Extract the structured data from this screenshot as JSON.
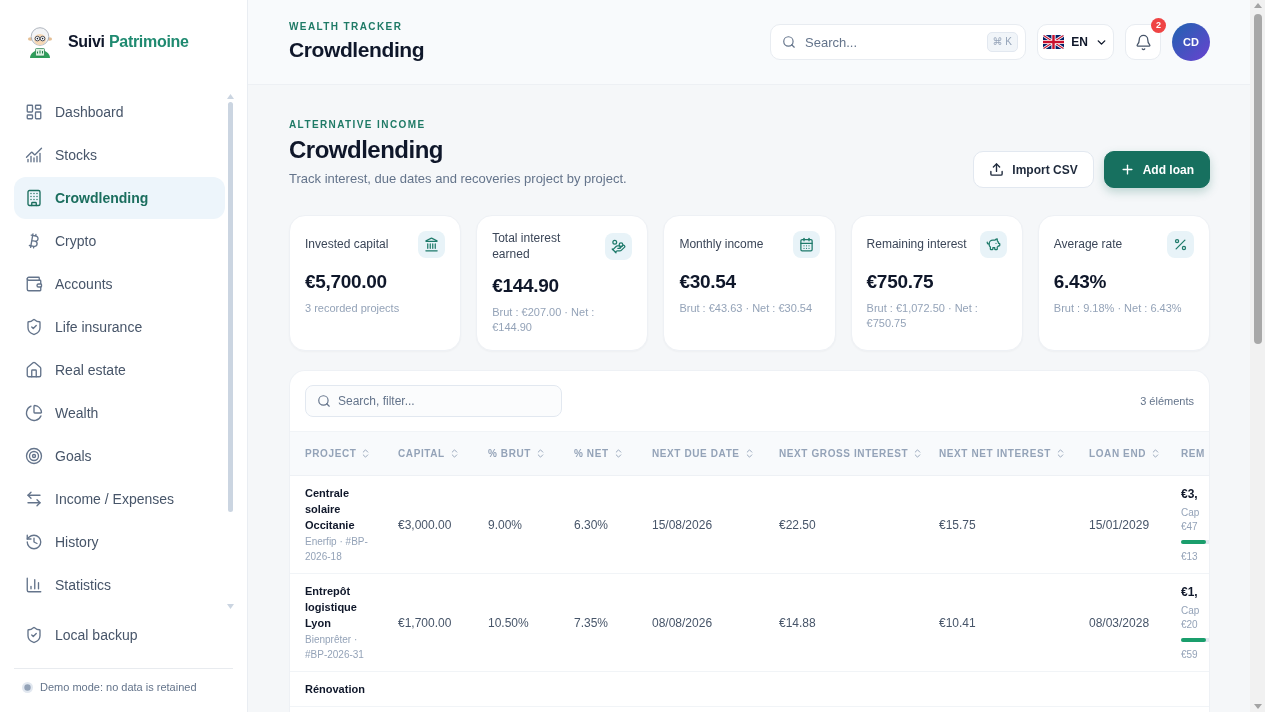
{
  "sidebar": {
    "brand": {
      "first_word": "Suivi",
      "second_word": "Patrimoine"
    },
    "nav_items": [
      {
        "label": "Dashboard",
        "selected": false
      },
      {
        "label": "Stocks",
        "selected": false
      },
      {
        "label": "Crowdlending",
        "selected": true
      },
      {
        "label": "Crypto",
        "selected": false
      },
      {
        "label": "Accounts",
        "selected": false
      },
      {
        "label": "Life insurance",
        "selected": false
      },
      {
        "label": "Real estate",
        "selected": false
      },
      {
        "label": "Wealth",
        "selected": false
      },
      {
        "label": "Goals",
        "selected": false
      },
      {
        "label": "Income / Expenses",
        "selected": false
      },
      {
        "label": "History",
        "selected": false
      },
      {
        "label": "Statistics",
        "selected": false
      }
    ],
    "footer_items": [
      {
        "label": "Local backup",
        "selected": false
      }
    ],
    "demo_notice": "Demo mode: no data is retained"
  },
  "header": {
    "eyebrow": "WEALTH TRACKER",
    "title": "Crowdlending",
    "search": {
      "placeholder": "Search...",
      "shortcut": "⌘ K"
    },
    "language": {
      "code": "EN"
    },
    "notifications": {
      "count": "2"
    },
    "avatar": {
      "initials": "CD"
    }
  },
  "page": {
    "eyebrow": "ALTERNATIVE INCOME",
    "title": "Crowdlending",
    "subtitle": "Track interest, due dates and recoveries project by project.",
    "actions": [
      {
        "label": "Import CSV",
        "kind": "secondary"
      },
      {
        "label": "Add loan",
        "kind": "primary"
      }
    ]
  },
  "stat_cards": [
    {
      "label": "Invested capital",
      "value": "€5,700.00",
      "detail": "3 recorded projects"
    },
    {
      "label": "Total interest earned",
      "value": "€144.90",
      "detail": "Brut : €207.00 · Net : €144.90"
    },
    {
      "label": "Monthly income",
      "value": "€30.54",
      "detail": "Brut : €43.63 · Net : €30.54"
    },
    {
      "label": "Remaining interest",
      "value": "€750.75",
      "detail": "Brut : €1,072.50 · Net : €750.75"
    },
    {
      "label": "Average rate",
      "value": "6.43%",
      "detail": "Brut : 9.18% · Net : 6.43%"
    }
  ],
  "table": {
    "search": {
      "placeholder": "Search, filter..."
    },
    "count": "3 éléments",
    "columns": [
      {
        "label": "PROJECT",
        "sortable": true
      },
      {
        "label": "CAPITAL",
        "sortable": true
      },
      {
        "label": "% BRUT",
        "sortable": true
      },
      {
        "label": "% NET",
        "sortable": true
      },
      {
        "label": "NEXT DUE DATE",
        "sortable": true
      },
      {
        "label": "NEXT GROSS INTEREST",
        "sortable": true
      },
      {
        "label": "NEXT NET INTEREST",
        "sortable": true
      },
      {
        "label": "LOAN END",
        "sortable": true
      },
      {
        "label": "REM",
        "sortable": false
      }
    ],
    "rows": [
      {
        "project": "Centrale solaire Occitanie",
        "platform": "Enerfip · #BP-2026-18",
        "capital": "€3,000.00",
        "gross_rate": "9.00%",
        "net_rate": "6.30%",
        "next_due_date": "15/08/2026",
        "next_gross_interest": "€22.50",
        "next_net_interest": "€15.75",
        "loan_end": "15/01/2029",
        "remaining": {
          "amount": "€3,",
          "detail_lines": [
            "Cap",
            "€47"
          ],
          "level": 0.9,
          "caption": "€13"
        }
      },
      {
        "project": "Entrepôt logistique Lyon",
        "platform": "Bienprêter · #BP-2026-31",
        "capital": "€1,700.00",
        "gross_rate": "10.50%",
        "net_rate": "7.35%",
        "next_due_date": "08/08/2026",
        "next_gross_interest": "€14.88",
        "next_net_interest": "€10.41",
        "loan_end": "08/03/2028",
        "remaining": {
          "amount": "€1,",
          "detail_lines": [
            "Cap",
            "€20"
          ],
          "level": 0.9,
          "caption": "€59"
        }
      },
      {
        "project": "Rénovation"
      }
    ]
  }
}
